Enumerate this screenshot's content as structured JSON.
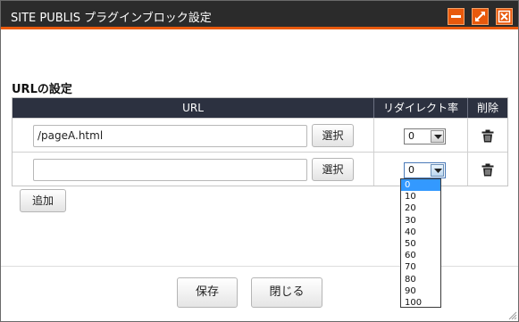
{
  "window": {
    "title": "SITE PUBLIS プラグインブロック設定",
    "accent_color": "#e8590c",
    "titlebar_color": "#2b2b2b"
  },
  "section": {
    "title": "URLの設定"
  },
  "table": {
    "headers": {
      "url": "URL",
      "rate": "リダイレクト率",
      "delete": "削除"
    },
    "header_color": "#2c3140",
    "rows": [
      {
        "url": "/pageA.html",
        "select_label": "選択",
        "rate": "0",
        "delete_icon": "trash-icon"
      },
      {
        "url": "",
        "select_label": "選択",
        "rate": "0",
        "delete_icon": "trash-icon"
      }
    ]
  },
  "add_label": "追加",
  "dropdown": {
    "options": [
      "0",
      "10",
      "20",
      "30",
      "40",
      "50",
      "60",
      "70",
      "80",
      "90",
      "100"
    ],
    "selected": "0",
    "highlight_color": "#3399ff"
  },
  "footer": {
    "save_label": "保存",
    "close_label": "閉じる"
  }
}
